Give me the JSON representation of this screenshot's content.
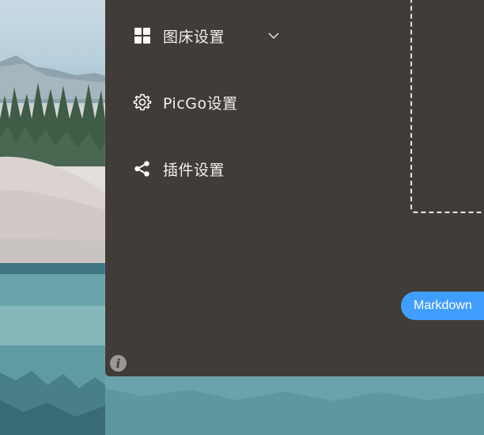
{
  "sidebar": {
    "items": [
      {
        "label": "图床设置",
        "icon": "grid-icon",
        "expandable": true
      },
      {
        "label": "PicGo设置",
        "icon": "gear-icon"
      },
      {
        "label": "插件设置",
        "icon": "share-icon"
      }
    ]
  },
  "main": {
    "format_button": "Markdown",
    "info_glyph": "i"
  },
  "colors": {
    "window_bg": "#413c37",
    "accent": "#409eff",
    "text": "#ffffff"
  }
}
